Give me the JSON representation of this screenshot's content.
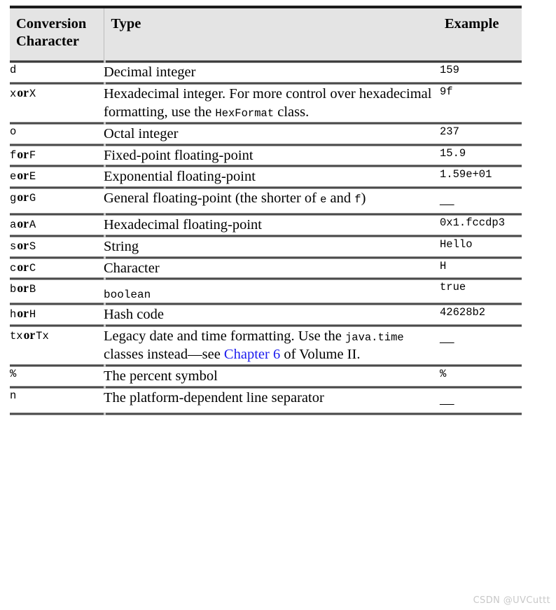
{
  "table": {
    "columns": [
      "Conversion Character",
      "Type",
      "Example"
    ],
    "rows": [
      {
        "conv_prefix": "d",
        "conv_or": "",
        "conv_suffix": "",
        "type_text": "Decimal integer",
        "type_mono": false,
        "example": "159",
        "example_is_dash": false
      },
      {
        "conv_prefix": "x",
        "conv_or": "or",
        "conv_suffix": "X",
        "type_text": "Hexadecimal integer. For more control over hexadecimal formatting, use the HexFormat class.",
        "type_part1": "Hexadecimal integer. For more control over hexadecimal formatting, use the ",
        "type_code1": "HexFormat",
        "type_part2": " class.",
        "type_mono": false,
        "example": "9f",
        "example_is_dash": false
      },
      {
        "conv_prefix": "o",
        "conv_or": "",
        "conv_suffix": "",
        "type_text": "Octal integer",
        "type_mono": false,
        "example": "237",
        "example_is_dash": false
      },
      {
        "conv_prefix": "f",
        "conv_or": "or",
        "conv_suffix": "F",
        "type_text": "Fixed-point floating-point",
        "type_mono": false,
        "example": "15.9",
        "example_is_dash": false
      },
      {
        "conv_prefix": "e",
        "conv_or": "or",
        "conv_suffix": "E",
        "type_text": "Exponential floating-point",
        "type_mono": false,
        "example": "1.59e+01",
        "example_is_dash": false
      },
      {
        "conv_prefix": "g",
        "conv_or": "or",
        "conv_suffix": "G",
        "type_text": "General floating-point (the shorter of e and f)",
        "type_part1": "General floating-point (the shorter of ",
        "type_code1": "e",
        "type_part2": " and ",
        "type_code2": "f",
        "type_part3": ")",
        "type_mono": false,
        "example": "—",
        "example_is_dash": true
      },
      {
        "conv_prefix": "a",
        "conv_or": "or",
        "conv_suffix": "A",
        "type_text": "Hexadecimal floating-point",
        "type_mono": false,
        "example": "0x1.fccdp3",
        "example_is_dash": false
      },
      {
        "conv_prefix": "s",
        "conv_or": "or",
        "conv_suffix": "S",
        "type_text": "String",
        "type_mono": false,
        "example": "Hello",
        "example_is_dash": false
      },
      {
        "conv_prefix": "c",
        "conv_or": "or",
        "conv_suffix": "C",
        "type_text": "Character",
        "type_mono": false,
        "example": "H",
        "example_is_dash": false
      },
      {
        "conv_prefix": "b",
        "conv_or": "or",
        "conv_suffix": "B",
        "type_text": "boolean",
        "type_mono": true,
        "example": "true",
        "example_is_dash": false
      },
      {
        "conv_prefix": "h",
        "conv_or": "or",
        "conv_suffix": "H",
        "type_text": "Hash code",
        "type_mono": false,
        "example": "42628b2",
        "example_is_dash": false
      },
      {
        "conv_prefix": "tx",
        "conv_or": "or",
        "conv_suffix": "Tx",
        "type_text": "Legacy date and time formatting. Use the java.time classes instead—see Chapter 6 of Volume II.",
        "type_part1": "Legacy date and time formatting. Use the ",
        "type_code1": "java.time",
        "type_part2": " classes instead—see ",
        "type_link": "Chapter 6",
        "type_part3": " of Volume II.",
        "type_mono": false,
        "example": "—",
        "example_is_dash": true
      },
      {
        "conv_prefix": "%",
        "conv_or": "",
        "conv_suffix": "",
        "type_text": "The percent symbol",
        "type_mono": false,
        "example": "%",
        "example_is_dash": false
      },
      {
        "conv_prefix": "n",
        "conv_or": "",
        "conv_suffix": "",
        "type_text": "The platform-dependent line separator",
        "type_mono": false,
        "example": "—",
        "example_is_dash": true
      }
    ]
  },
  "watermark": {
    "text": "CSDN @UVCuttt"
  },
  "colors": {
    "header_background": "#e4e4e4",
    "link_blue": "#1a1aee",
    "rule_dark": "#4a4a4a",
    "top_rule": "#1c1c1c",
    "watermark_gray": "#c8c8c8"
  }
}
